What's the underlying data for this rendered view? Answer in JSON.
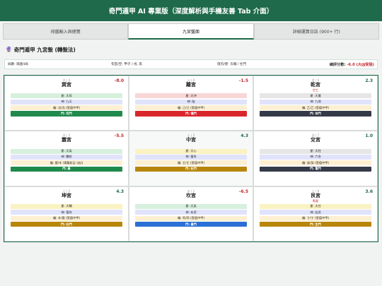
{
  "header": {
    "title": "奇門遁甲 AI 專業版（深度解析與手機友善 Tab 介面）"
  },
  "tabs": [
    {
      "label": "排盤輸入與總覽",
      "active": false
    },
    {
      "label": "九宮盤面",
      "active": true
    },
    {
      "label": "詳細運算日誌 (900+ 行)",
      "active": false
    }
  ],
  "section": {
    "icon": "🔮",
    "title": "奇門遁甲 九宮盤 (轉盤法)"
  },
  "info": {
    "ju": "局數: 陽遁4局",
    "xun": "旬首/空: 甲子 / 戌, 亥",
    "zhifu": "值符/使: 天輔 / 杜門",
    "total_label": "總評分數: ",
    "total_value": "-6.0 (大凶受阻)"
  },
  "colors": {
    "brand": "#1e6a4a",
    "negative": "#c0282e",
    "door_green": "#1f8a4c",
    "door_red": "#d9262c",
    "door_dark": "#353a48",
    "door_gold": "#b8860b",
    "door_blue": "#2b6fd6"
  },
  "palaces": [
    {
      "meta": "木 | 4",
      "name": "巽宮",
      "score": "-8.0",
      "score_sign": "neg",
      "subtitle": "",
      "star": "星: 天芮",
      "star_tone": "",
      "god": "神: 九天",
      "stem": "儀: 戊/戊 (受值中甲)",
      "door": "門: 死門",
      "door_color": "#1f8a4c"
    },
    {
      "meta": "火 | 9",
      "name": "離宮",
      "score": "-1.5",
      "score_sign": "neg",
      "subtitle": "",
      "star": "星: 天沖",
      "star_tone": "red",
      "god": "神: 陰",
      "stem": "儀: 己/己 (受值中甲)",
      "door": "門: 傷門",
      "door_color": "#d9262c"
    },
    {
      "meta": "金 | 6",
      "name": "乾宮",
      "score": "2.3",
      "score_sign": "pos",
      "subtitle": "空亡",
      "star": "星: 天蓬",
      "star_tone": "grey",
      "god": "神: 九地",
      "stem": "儀: 乙/乙 (受值中甲)",
      "door": "門: 休門",
      "door_color": "#353a48"
    },
    {
      "meta": "木 | 3",
      "name": "震宮",
      "score": "-5.5",
      "score_sign": "neg",
      "subtitle": "",
      "star": "星: 天英",
      "star_tone": "",
      "god": "神: 騰蛇",
      "stem": "儀: 庚/辛 (青龍折足 (凶))",
      "door": "門: 景",
      "door_color": "#1f8a4c"
    },
    {
      "meta": "土 | 5",
      "name": "中宮",
      "score": "4.3",
      "score_sign": "pos",
      "subtitle": "",
      "star": "星: 天心",
      "star_tone": "yellow",
      "god": "神: 值符",
      "stem": "儀: 壬/壬 (受值中甲)",
      "door": "門: 杜門",
      "door_color": "#b8860b"
    },
    {
      "meta": "金 | 7",
      "name": "兌宮",
      "score": "1.0",
      "score_sign": "pos",
      "subtitle": "",
      "star": "星: 天柱",
      "star_tone": "grey",
      "god": "神: 六合",
      "stem": "儀: 癸/癸 (受值中甲)",
      "door": "門: 驚門",
      "door_color": "#353a48"
    },
    {
      "meta": "土 | 2",
      "name": "坤宮",
      "score": "4.3",
      "score_sign": "pos",
      "subtitle": "",
      "star": "星: 天輔",
      "star_tone": "yellow",
      "god": "神: 值符",
      "stem": "儀: 辛/庚 (受值中甲)",
      "door": "門: 杜門",
      "door_color": "#b8860b"
    },
    {
      "meta": "水 | 1",
      "name": "坎宮",
      "score": "-6.5",
      "score_sign": "neg",
      "subtitle": "",
      "star": "星: 天英",
      "star_tone": "",
      "god": "神: 玄武",
      "stem": "儀: 丙/丙 (受值中甲)",
      "door": "門: 景門",
      "door_color": "#2b6fd6"
    },
    {
      "meta": "土 | 8",
      "name": "艮宮",
      "score": "3.6",
      "score_sign": "pos",
      "subtitle": "馬星",
      "star": "星: 天任",
      "star_tone": "yellow",
      "god": "神: 白虎",
      "stem": "儀: 丁/丁 (受值中甲)",
      "door": "門: 生門",
      "door_color": "#b8860b"
    }
  ]
}
